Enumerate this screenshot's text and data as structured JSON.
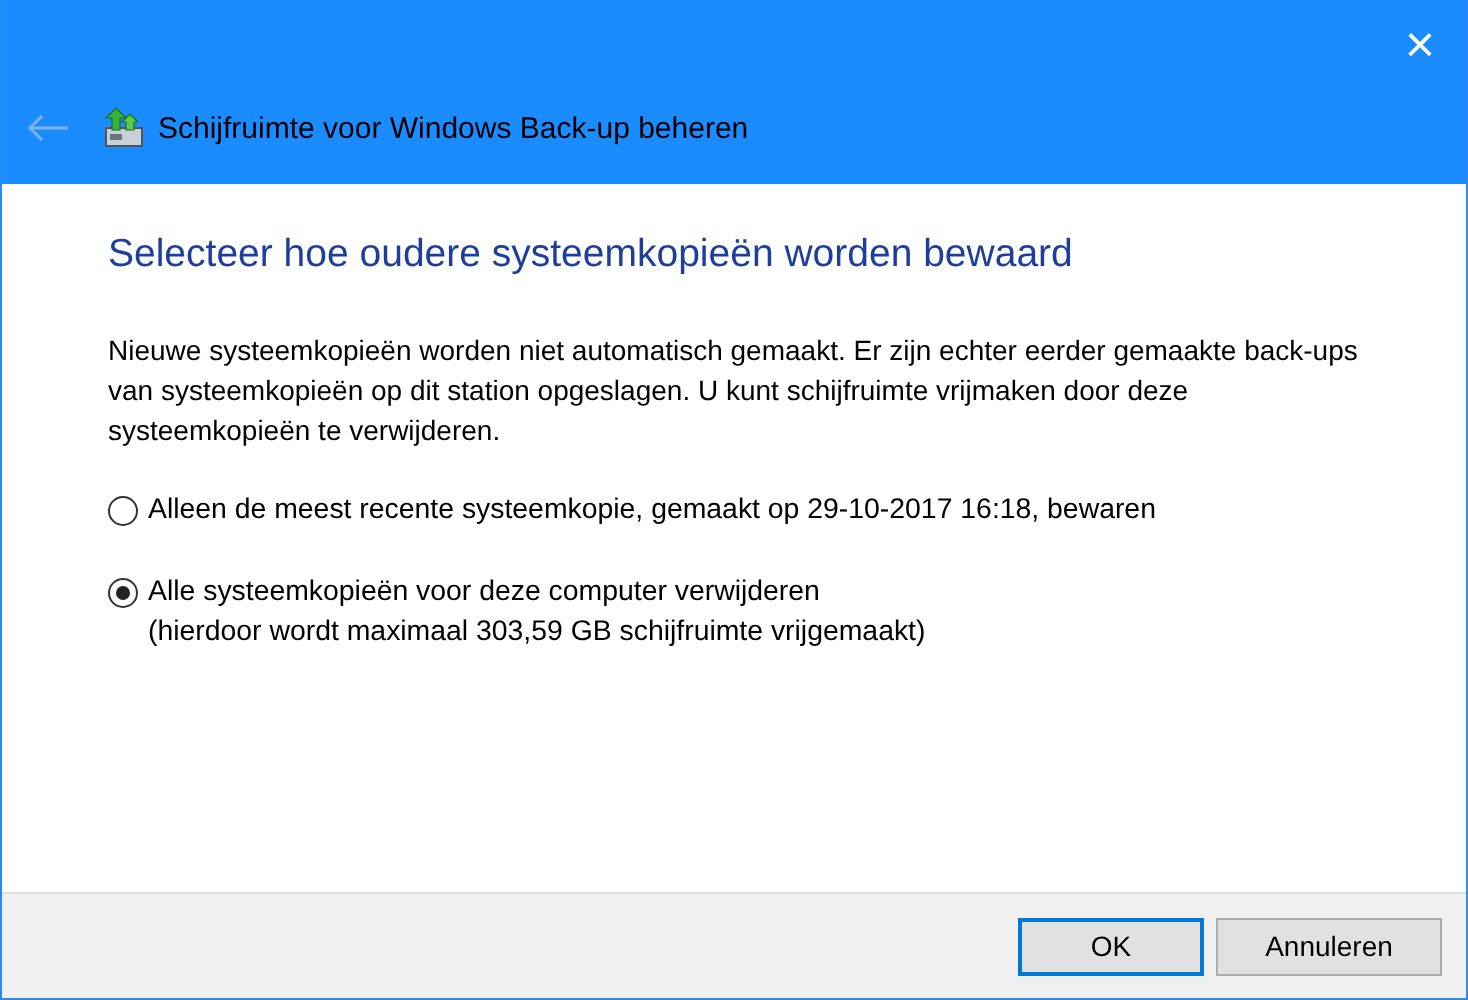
{
  "window": {
    "title": "Schijfruimte voor Windows Back-up beheren",
    "close": "×"
  },
  "heading": "Selecteer hoe oudere systeemkopieën worden bewaard",
  "description": "Nieuwe systeemkopieën worden niet automatisch gemaakt. Er zijn echter eerder gemaakte back-ups van systeemkopieën op dit station opgeslagen. U kunt schijfruimte vrijmaken door deze systeemkopieën te verwijderen.",
  "options": [
    {
      "label": "Alleen de meest recente systeemkopie, gemaakt op 29-10-2017 16:18, bewaren",
      "selected": false
    },
    {
      "label": "Alle systeemkopieën voor deze computer verwijderen",
      "note": "(hierdoor wordt maximaal 303,59 GB schijfruimte vrijgemaakt)",
      "selected": true
    }
  ],
  "buttons": [
    {
      "label": "OK",
      "default": true
    },
    {
      "label": "Annuleren",
      "default": false
    }
  ]
}
